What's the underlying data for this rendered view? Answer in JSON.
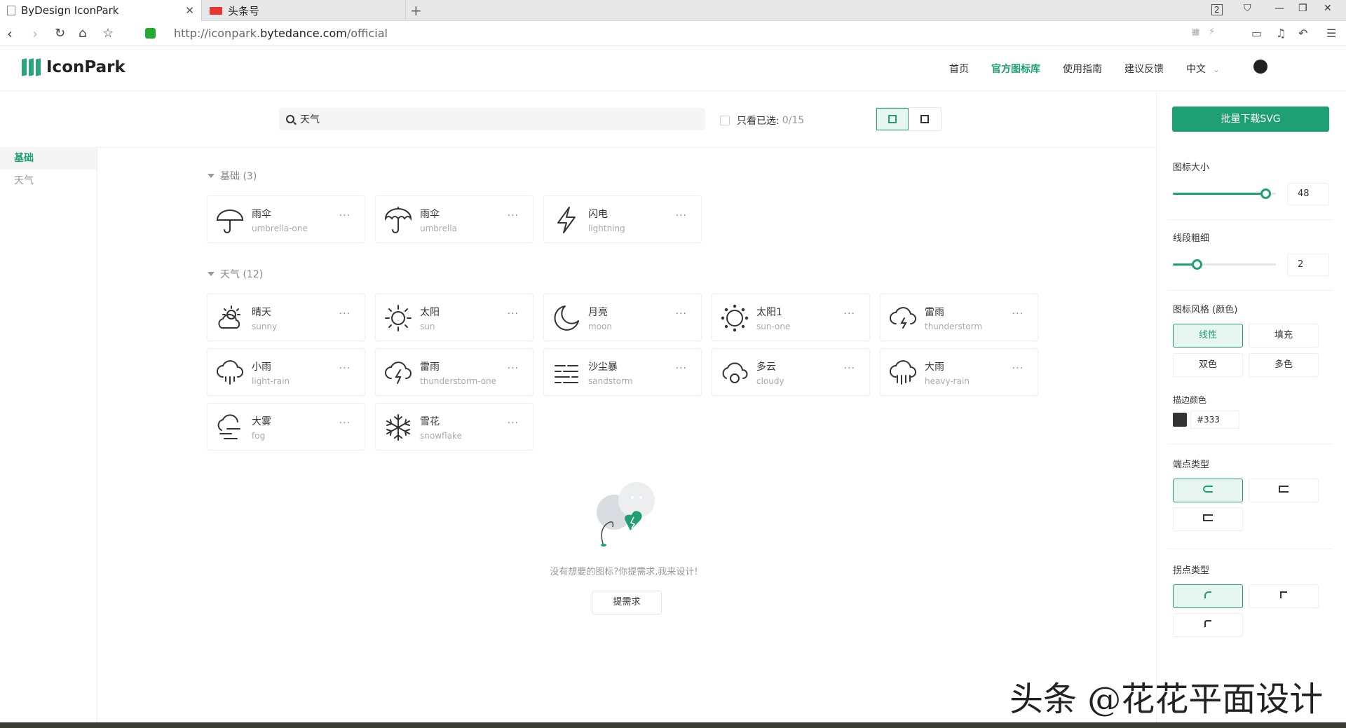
{
  "browser": {
    "tabs": [
      {
        "title": "ByDesign IconPark",
        "active": true
      },
      {
        "title": "头条号",
        "active": false
      }
    ],
    "window_count": "2",
    "url_prefix": "http://iconpark.",
    "url_domain": "bytedance.com",
    "url_path": "/official"
  },
  "header": {
    "logo_text": "IconPark",
    "nav": [
      "首页",
      "官方图标库",
      "使用指南",
      "建议反馈",
      "中文"
    ],
    "active_nav": "官方图标库"
  },
  "sidebar": {
    "items": [
      "基础",
      "天气"
    ],
    "active": "基础"
  },
  "toolbar": {
    "search_value": "天气",
    "only_selected_label": "只看已选:",
    "only_selected_count": "0/15"
  },
  "groups": [
    {
      "title": "基础 (3)",
      "icons": [
        {
          "cn": "雨伞",
          "en": "umbrella-one",
          "icon": "umbrella-one-icon"
        },
        {
          "cn": "雨伞",
          "en": "umbrella",
          "icon": "umbrella-icon"
        },
        {
          "cn": "闪电",
          "en": "lightning",
          "icon": "lightning-icon"
        }
      ]
    },
    {
      "title": "天气 (12)",
      "icons": [
        {
          "cn": "晴天",
          "en": "sunny",
          "icon": "sunny-icon"
        },
        {
          "cn": "太阳",
          "en": "sun",
          "icon": "sun-icon"
        },
        {
          "cn": "月亮",
          "en": "moon",
          "icon": "moon-icon"
        },
        {
          "cn": "太阳1",
          "en": "sun-one",
          "icon": "sun-one-icon"
        },
        {
          "cn": "雷雨",
          "en": "thunderstorm",
          "icon": "thunderstorm-icon"
        },
        {
          "cn": "小雨",
          "en": "light-rain",
          "icon": "light-rain-icon"
        },
        {
          "cn": "雷雨",
          "en": "thunderstorm-one",
          "icon": "thunderstorm-one-icon"
        },
        {
          "cn": "沙尘暴",
          "en": "sandstorm",
          "icon": "sandstorm-icon"
        },
        {
          "cn": "多云",
          "en": "cloudy",
          "icon": "cloudy-icon"
        },
        {
          "cn": "大雨",
          "en": "heavy-rain",
          "icon": "heavy-rain-icon"
        },
        {
          "cn": "大雾",
          "en": "fog",
          "icon": "fog-icon"
        },
        {
          "cn": "雪花",
          "en": "snowflake",
          "icon": "snowflake-icon"
        }
      ]
    }
  ],
  "more_label": "···",
  "empty": {
    "text": "没有想要的图标?你提需求,我来设计!",
    "button": "提需求"
  },
  "panel": {
    "download_button": "批量下载SVG",
    "size_label": "图标大小",
    "size_value": "48",
    "size_fraction": 0.9,
    "stroke_label": "线段粗细",
    "stroke_value": "2",
    "stroke_fraction": 0.23,
    "style_label": "图标风格 (颜色)",
    "styles": [
      "线性",
      "填充",
      "双色",
      "多色"
    ],
    "active_style": "线性",
    "stroke_color_label": "描边颜色",
    "stroke_color": "#333",
    "cap_label": "端点类型",
    "join_label": "拐点类型"
  },
  "colors": {
    "accent": "#1f9f74",
    "text": "#333333"
  },
  "watermark": "头条 @花花平面设计"
}
